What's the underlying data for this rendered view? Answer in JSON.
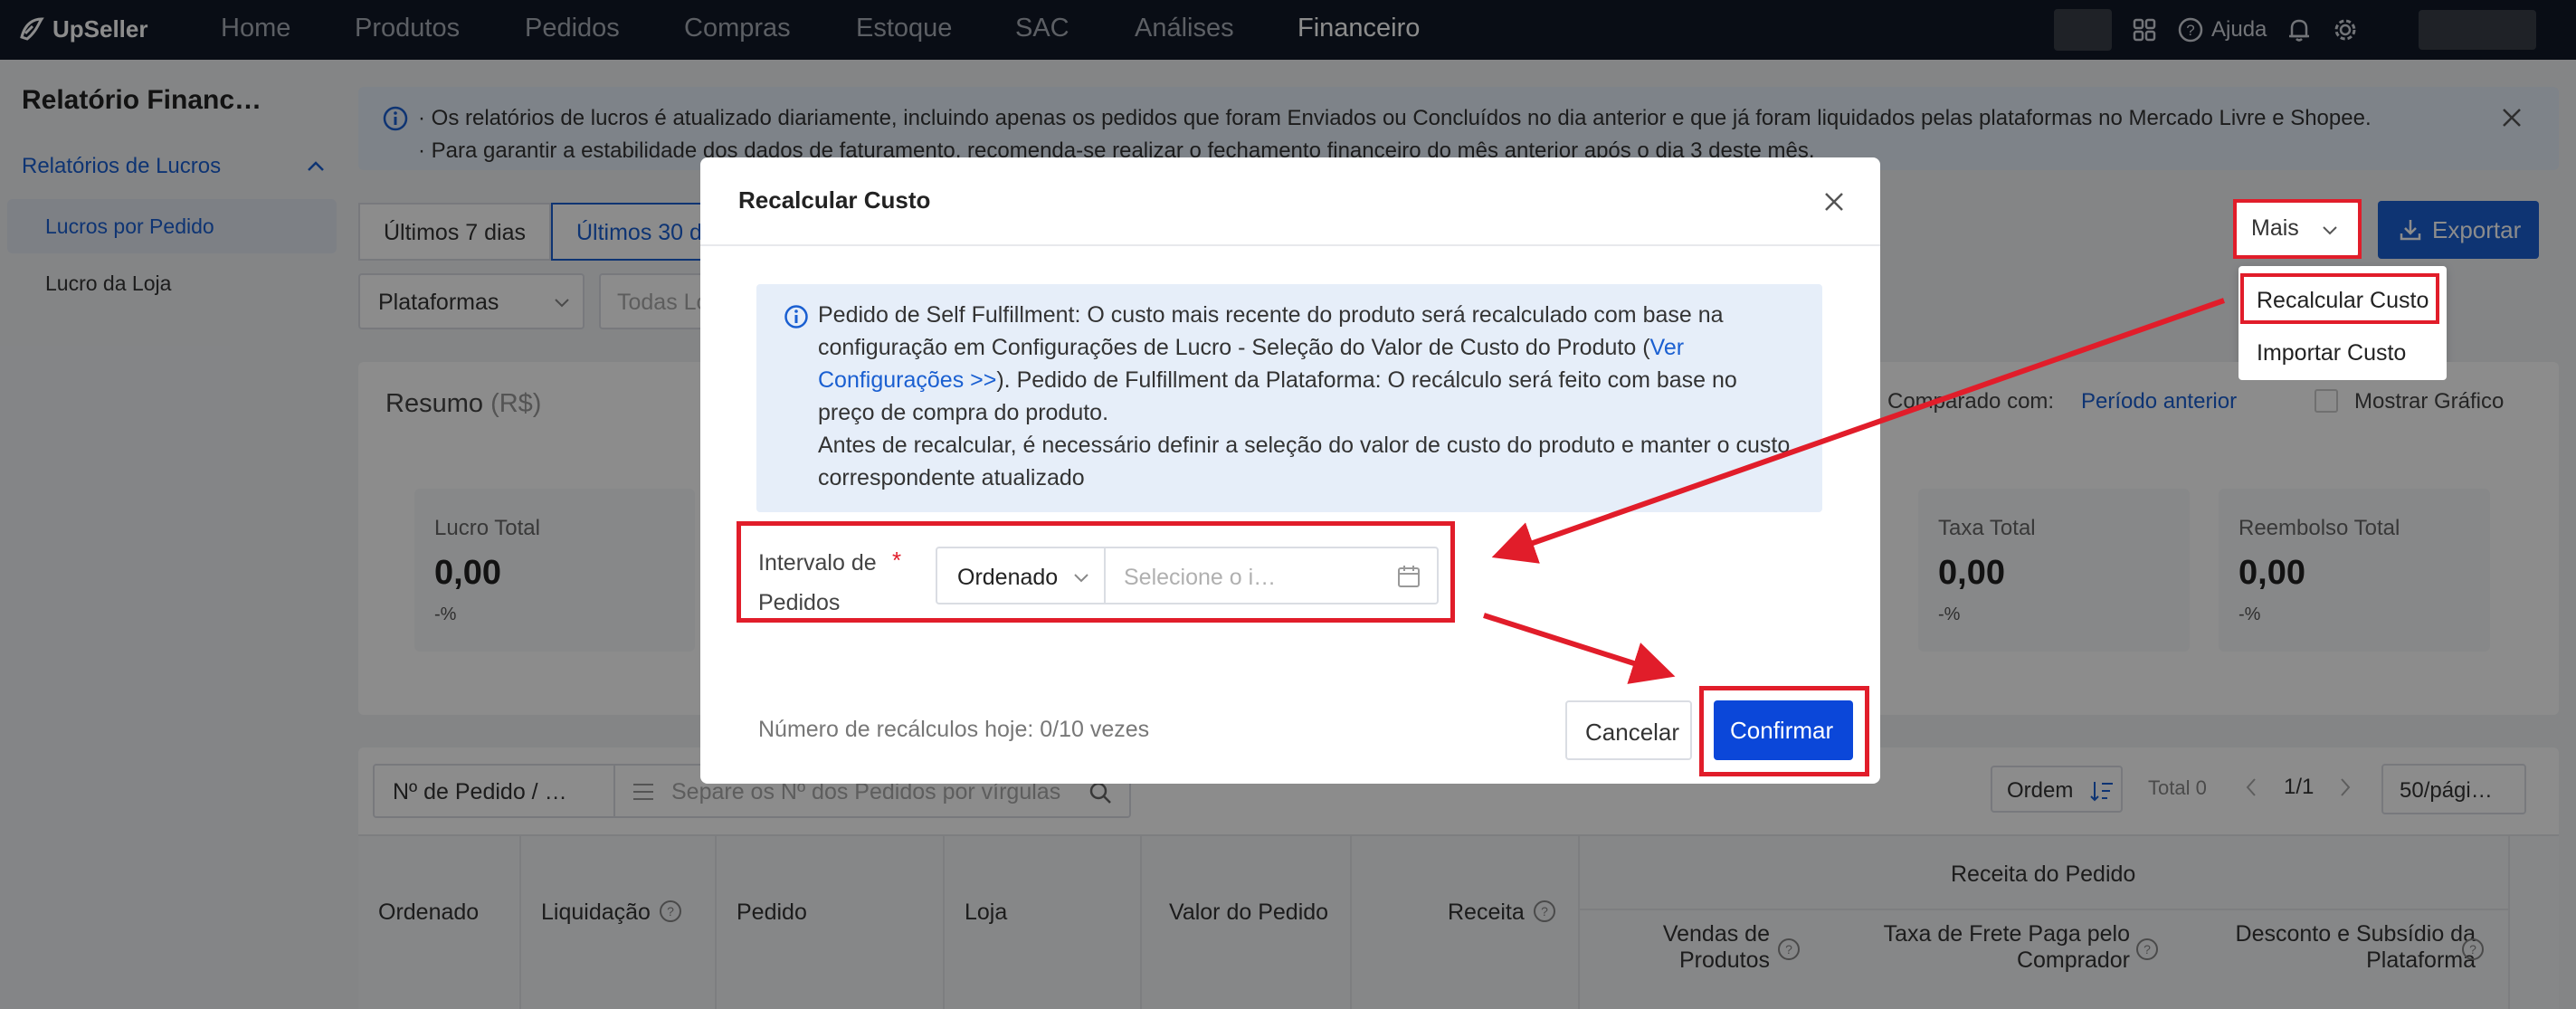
{
  "app": {
    "name": "UpSeller"
  },
  "nav": {
    "items": [
      "Home",
      "Produtos",
      "Pedidos",
      "Compras",
      "Estoque",
      "SAC",
      "Análises",
      "Financeiro"
    ],
    "help": "Ajuda"
  },
  "sidebar": {
    "title": "Relatório Financ…",
    "group": "Relatórios de Lucros",
    "items": [
      "Lucros por Pedido",
      "Lucro da Loja"
    ]
  },
  "banner": {
    "line1": "· Os relatórios de lucros é atualizado diariamente, incluindo apenas os pedidos que foram Enviados ou Concluídos no dia anterior e que já foram liquidados pelas plataformas no Mercado Livre e Shopee.",
    "line2": "· Para garantir a estabilidade dos dados de faturamento, recomenda-se realizar o fechamento financeiro do mês anterior após o dia 3 deste mês."
  },
  "date_tabs": [
    "Últimos 7 dias",
    "Últimos 30 d"
  ],
  "filters": {
    "platforms": "Plataformas",
    "stores": "Todas Lo"
  },
  "toolbar": {
    "more": "Mais",
    "export": "Exportar"
  },
  "more_menu": [
    "Recalcular Custo",
    "Importar Custo"
  ],
  "summary": {
    "title": "Resumo",
    "currency": "(R$)",
    "compare_label": "Comparado com:",
    "compare_value": "Período anterior",
    "show_chart": "Mostrar Gráfico",
    "metrics": [
      {
        "label": "Lucro Total",
        "value": "0,00",
        "change": "-%"
      },
      {
        "label": "Taxa Total",
        "value": "0,00",
        "change": "-%"
      },
      {
        "label": "Reembolso Total",
        "value": "0,00",
        "change": "-%"
      }
    ]
  },
  "table": {
    "search_select": "Nº de Pedido / …",
    "search_placeholder": "Separe os Nº dos Pedidos por vírgulas",
    "order_label": "Ordem",
    "total": "Total 0",
    "page": "1/1",
    "per_page": "50/pági…",
    "columns": [
      "Ordenado",
      "Liquidação",
      "Pedido",
      "Loja",
      "Valor do Pedido",
      "Receita"
    ],
    "group_header": "Receita do Pedido",
    "sub_columns": [
      [
        "Vendas de",
        "Produtos"
      ],
      [
        "Taxa de Frete Paga pelo",
        "Comprador"
      ],
      [
        "Desconto e Subsídio da",
        "Plataforma"
      ]
    ]
  },
  "modal": {
    "title": "Recalcular Custo",
    "info_part1": "Pedido de Self Fulfillment: O custo mais recente do produto será recalculado com base na configuração em Configurações de Lucro - Seleção do Valor de Custo do Produto (",
    "info_link": "Ver Configurações >>",
    "info_part2": "). Pedido de Fulfillment da Plataforma: O recálculo será feito com base no preço de compra do produto.",
    "info_part3": "Antes de recalcular, é necessário definir a seleção do valor de custo do produto e manter o custo correspondente atualizado",
    "range_label_1": "Intervalo de",
    "range_label_2": "Pedidos",
    "required_mark": "*",
    "range_type": "Ordenado",
    "date_placeholder": "Selecione o i…",
    "recalc_count": "Número de recálculos hoje: 0/10 vezes",
    "cancel": "Cancelar",
    "confirm": "Confirmar"
  },
  "colors": {
    "accent": "#1a5fd1",
    "confirm": "#0b47d9",
    "annotation": "#e11d2a",
    "topbar": "#111827"
  }
}
